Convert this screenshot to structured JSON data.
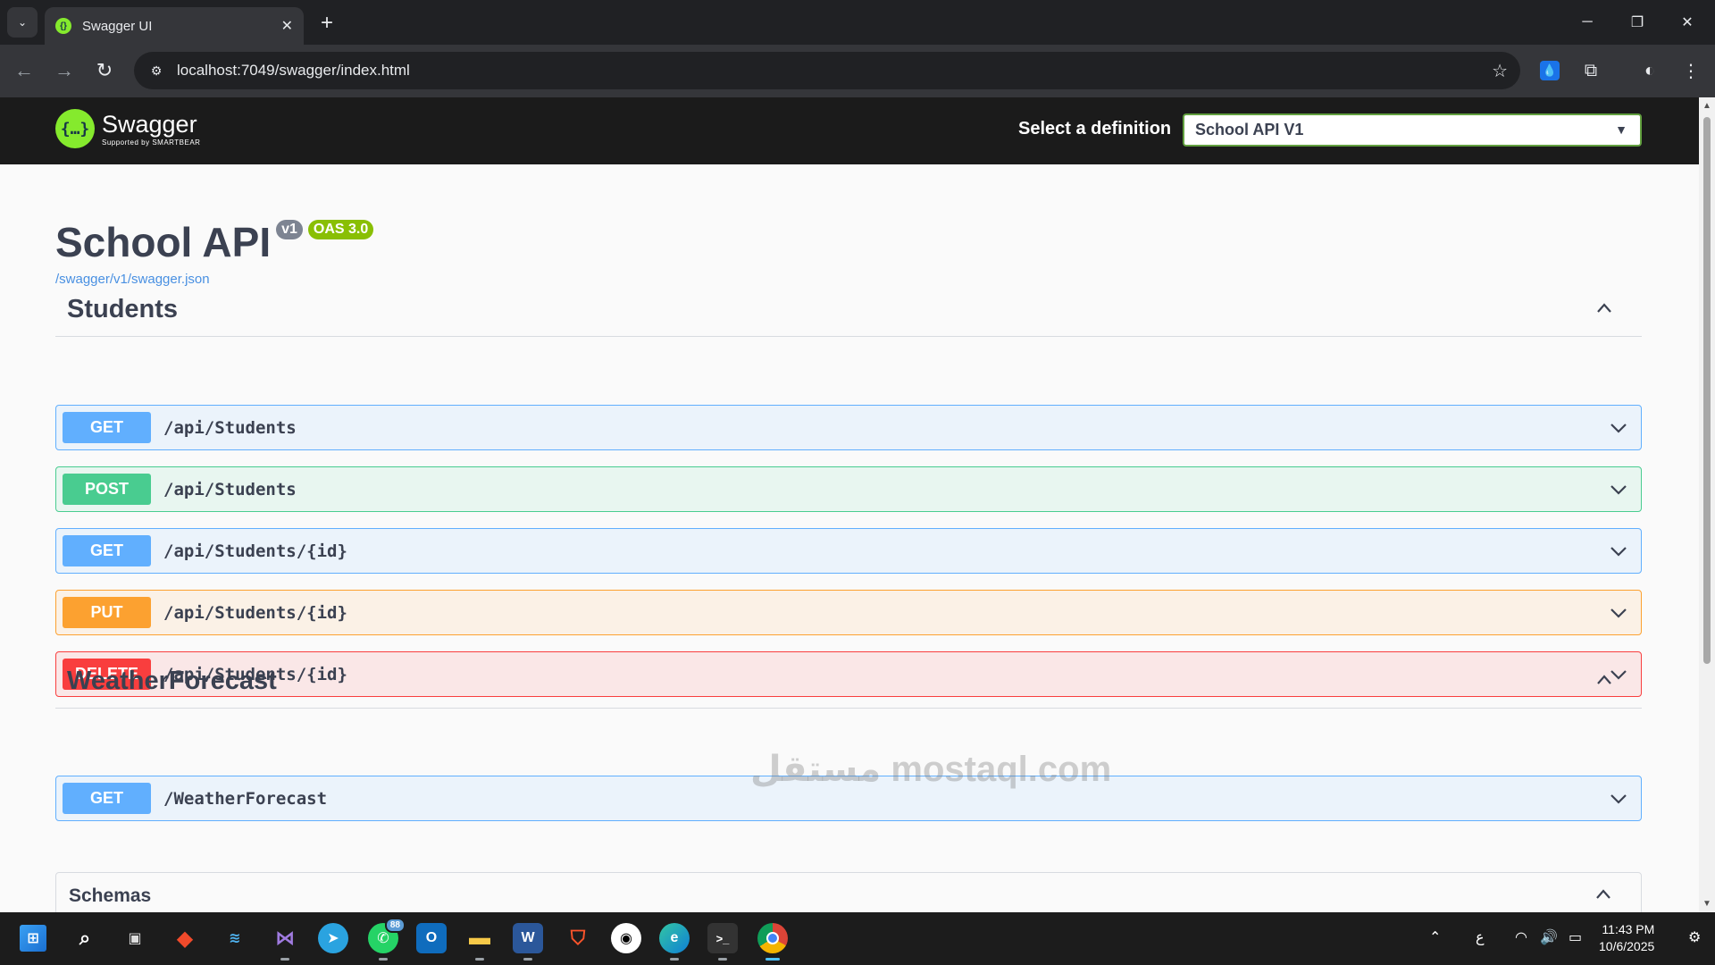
{
  "browser": {
    "tab_title": "Swagger UI",
    "tab_close": "✕",
    "new_tab": "+",
    "url": "localhost:7049/swagger/index.html"
  },
  "swagger": {
    "brand_name": "Swagger",
    "brand_sub": "Supported by SMARTBEAR",
    "definition_label": "Select a definition",
    "definition_value": "School API V1",
    "title": "School API",
    "version_badge": "v1",
    "oas_badge": "OAS 3.0",
    "spec_link": "/swagger/v1/swagger.json"
  },
  "tags": [
    {
      "name": "Students",
      "operations": [
        {
          "method": "GET",
          "path": "/api/Students"
        },
        {
          "method": "POST",
          "path": "/api/Students"
        },
        {
          "method": "GET",
          "path": "/api/Students/{id}"
        },
        {
          "method": "PUT",
          "path": "/api/Students/{id}"
        },
        {
          "method": "DELETE",
          "path": "/api/Students/{id}"
        }
      ]
    },
    {
      "name": "WeatherForecast",
      "operations": [
        {
          "method": "GET",
          "path": "/WeatherForecast"
        }
      ]
    }
  ],
  "schemas_title": "Schemas",
  "watermark": "مستقل mostaql.com",
  "taskbar": {
    "whatsapp_badge": "88",
    "lang_indicator": "ع",
    "time": "11:43 PM",
    "date": "10/6/2025"
  },
  "colors": {
    "get": "#61affe",
    "post": "#49cc90",
    "put": "#fca130",
    "delete": "#f93e3e",
    "swagger_green": "#85ea2d"
  }
}
